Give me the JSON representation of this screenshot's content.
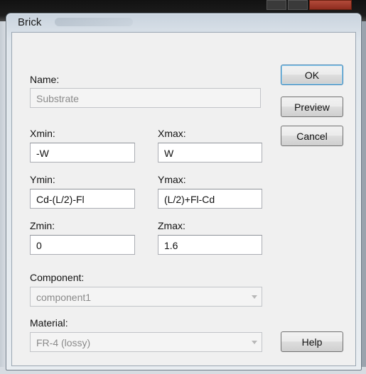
{
  "dialog": {
    "title": "Brick",
    "name_label": "Name:",
    "name_value": "Substrate",
    "xmin_label": "Xmin:",
    "xmin_value": "-W",
    "xmax_label": "Xmax:",
    "xmax_value": "W",
    "ymin_label": "Ymin:",
    "ymin_value": "Cd-(L/2)-Fl",
    "ymax_label": "Ymax:",
    "ymax_value": "(L/2)+Fl-Cd",
    "zmin_label": "Zmin:",
    "zmin_value": "0",
    "zmax_label": "Zmax:",
    "zmax_value": "1.6",
    "component_label": "Component:",
    "component_value": "component1",
    "material_label": "Material:",
    "material_value": "FR-4 (lossy)"
  },
  "buttons": {
    "ok": "OK",
    "preview": "Preview",
    "cancel": "Cancel",
    "help": "Help"
  }
}
